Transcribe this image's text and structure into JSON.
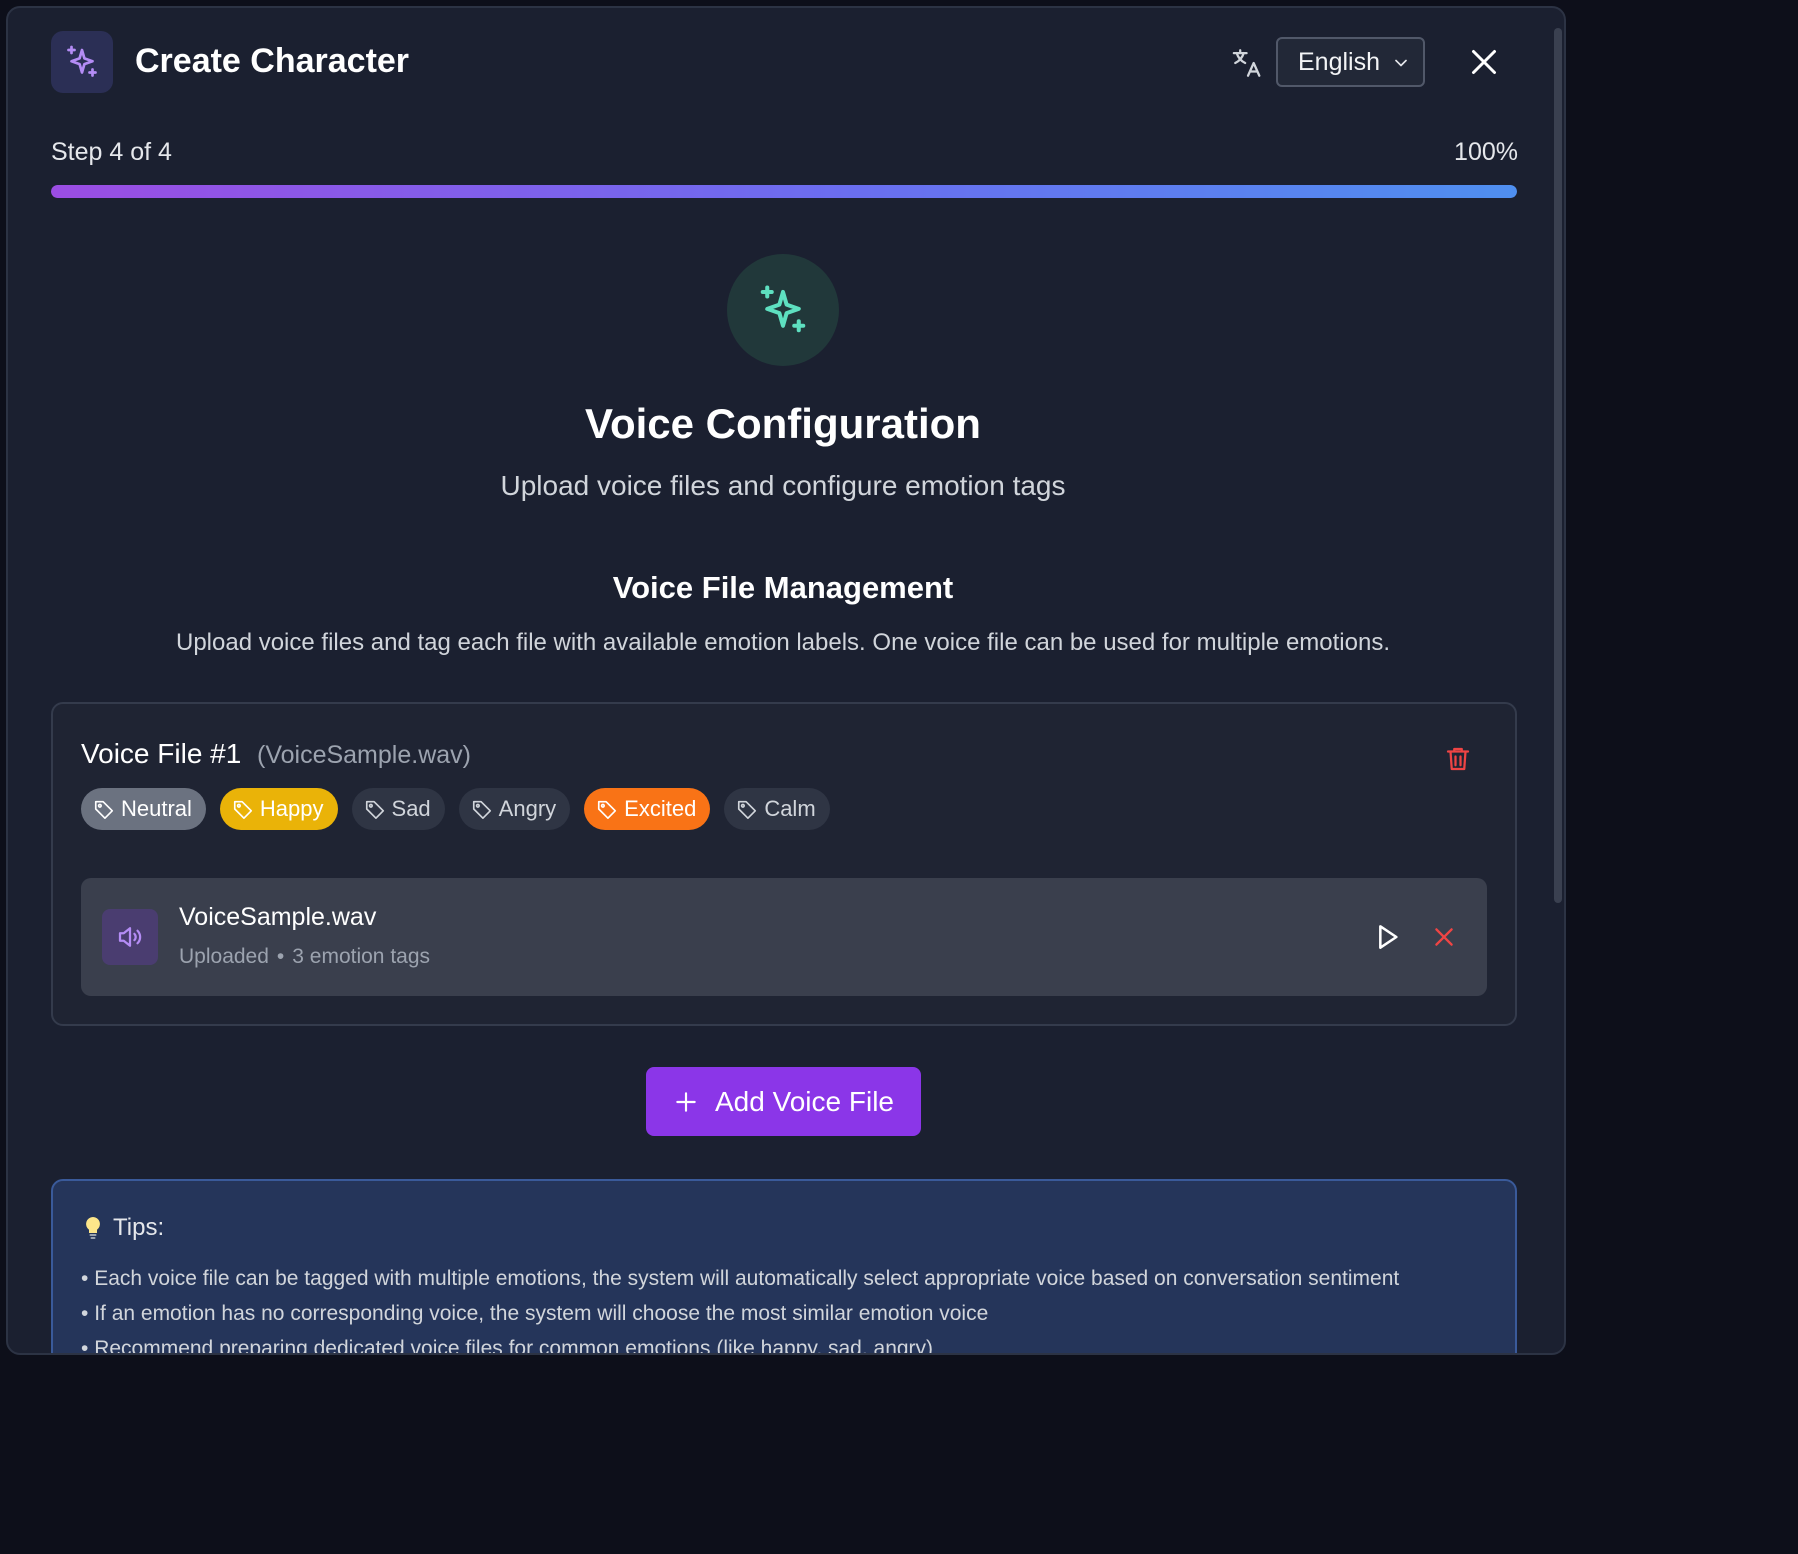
{
  "header": {
    "title": "Create Character",
    "language": "English",
    "icons": {
      "logo": "sparkles-icon",
      "translate": "translate-icon",
      "close": "close-icon"
    }
  },
  "progress": {
    "step_label": "Step 4 of 4",
    "percent_label": "100%",
    "value": 1.0,
    "gradient": [
      "#9b4de3",
      "#4f8ff0"
    ]
  },
  "section": {
    "title": "Voice Configuration",
    "subtitle": "Upload voice files and configure emotion tags",
    "icon": "sparkles-icon"
  },
  "management": {
    "title": "Voice File Management",
    "description": "Upload voice files and tag each file with available emotion labels. One voice file can be used for multiple emotions."
  },
  "voice_file": {
    "title": "Voice File #1",
    "file_label": "(VoiceSample.wav)",
    "tags": [
      {
        "label": "Neutral",
        "active": true,
        "color": "#6b7280"
      },
      {
        "label": "Happy",
        "active": true,
        "color": "#eab308"
      },
      {
        "label": "Sad",
        "active": false
      },
      {
        "label": "Angry",
        "active": false
      },
      {
        "label": "Excited",
        "active": true,
        "color": "#f97316"
      },
      {
        "label": "Calm",
        "active": false
      }
    ],
    "file": {
      "name": "VoiceSample.wav",
      "status": "Uploaded",
      "separator": "•",
      "tag_count": "3 emotion tags"
    }
  },
  "add_button": {
    "label": "Add Voice File",
    "color": "#8b36e8"
  },
  "tips": {
    "title": "Tips:",
    "items": [
      "Each voice file can be tagged with multiple emotions, the system will automatically select appropriate voice based on conversation sentiment",
      "If an emotion has no corresponding voice, the system will choose the most similar emotion voice",
      "Recommend preparing dedicated voice files for common emotions (like happy, sad, angry)"
    ]
  }
}
